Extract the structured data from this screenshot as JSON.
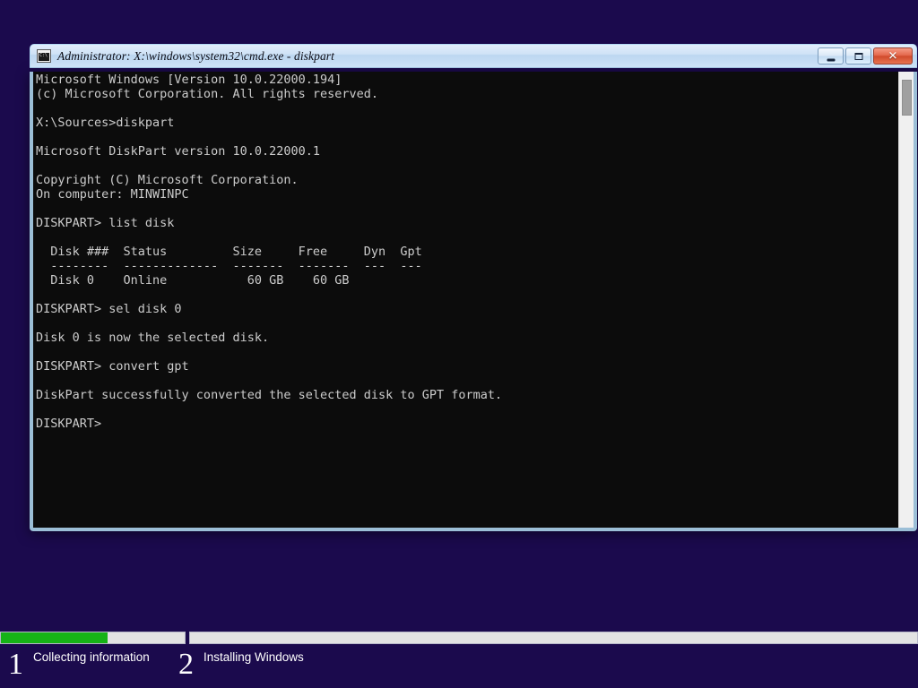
{
  "window": {
    "title": "Administrator: X:\\windows\\system32\\cmd.exe - diskpart",
    "icon": "cmd-console-icon",
    "controls": {
      "minimize_label": "–",
      "maximize_label": "□",
      "close_label": "✕"
    }
  },
  "console": {
    "lines": [
      "Microsoft Windows [Version 10.0.22000.194]",
      "(c) Microsoft Corporation. All rights reserved.",
      "",
      "X:\\Sources>diskpart",
      "",
      "Microsoft DiskPart version 10.0.22000.1",
      "",
      "Copyright (C) Microsoft Corporation.",
      "On computer: MINWINPC",
      "",
      "DISKPART> list disk",
      "",
      "  Disk ###  Status         Size     Free     Dyn  Gpt",
      "  --------  -------------  -------  -------  ---  ---",
      "  Disk 0    Online           60 GB    60 GB",
      "",
      "DISKPART> sel disk 0",
      "",
      "Disk 0 is now the selected disk.",
      "",
      "DISKPART> convert gpt",
      "",
      "DiskPart successfully converted the selected disk to GPT format.",
      "",
      "DISKPART>"
    ],
    "text_color": "#cccccc",
    "background_color": "#0c0c0c"
  },
  "setup": {
    "progress": {
      "segments": [
        {
          "name": "collecting-information",
          "fill_percent": 58
        },
        {
          "name": "installing-windows",
          "fill_percent": 0
        }
      ],
      "fill_color": "#16b316",
      "track_color": "#e3e3e3"
    },
    "steps": [
      {
        "number": "1",
        "label": "Collecting information"
      },
      {
        "number": "2",
        "label": "Installing Windows"
      }
    ]
  }
}
